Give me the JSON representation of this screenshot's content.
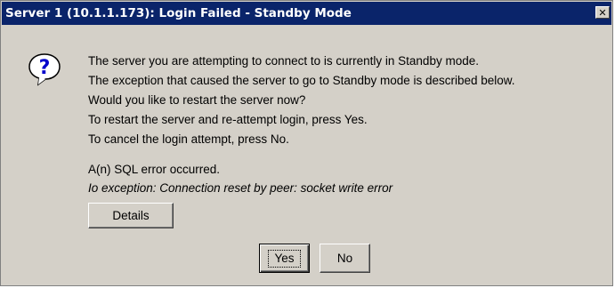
{
  "window": {
    "title": "Server 1 (10.1.1.173): Login Failed - Standby Mode",
    "close_glyph": "✕"
  },
  "icon": {
    "name": "question-icon",
    "glyph": "?",
    "color": "#0000cc"
  },
  "message": {
    "lines": [
      "The server you are attempting to connect to is currently in Standby mode.",
      "The exception that caused the server to go to Standby mode is described below.",
      "Would you like to restart the server now?",
      "To restart the server and re-attempt login, press Yes.",
      "To cancel the login attempt, press No."
    ]
  },
  "error": {
    "title": "A(n) SQL error occurred.",
    "detail": "Io exception: Connection reset by peer: socket write error"
  },
  "buttons": {
    "details": "Details",
    "yes": "Yes",
    "no": "No"
  },
  "colors": {
    "titlebar": "#0a246a",
    "dialog_bg": "#d4d0c8"
  }
}
